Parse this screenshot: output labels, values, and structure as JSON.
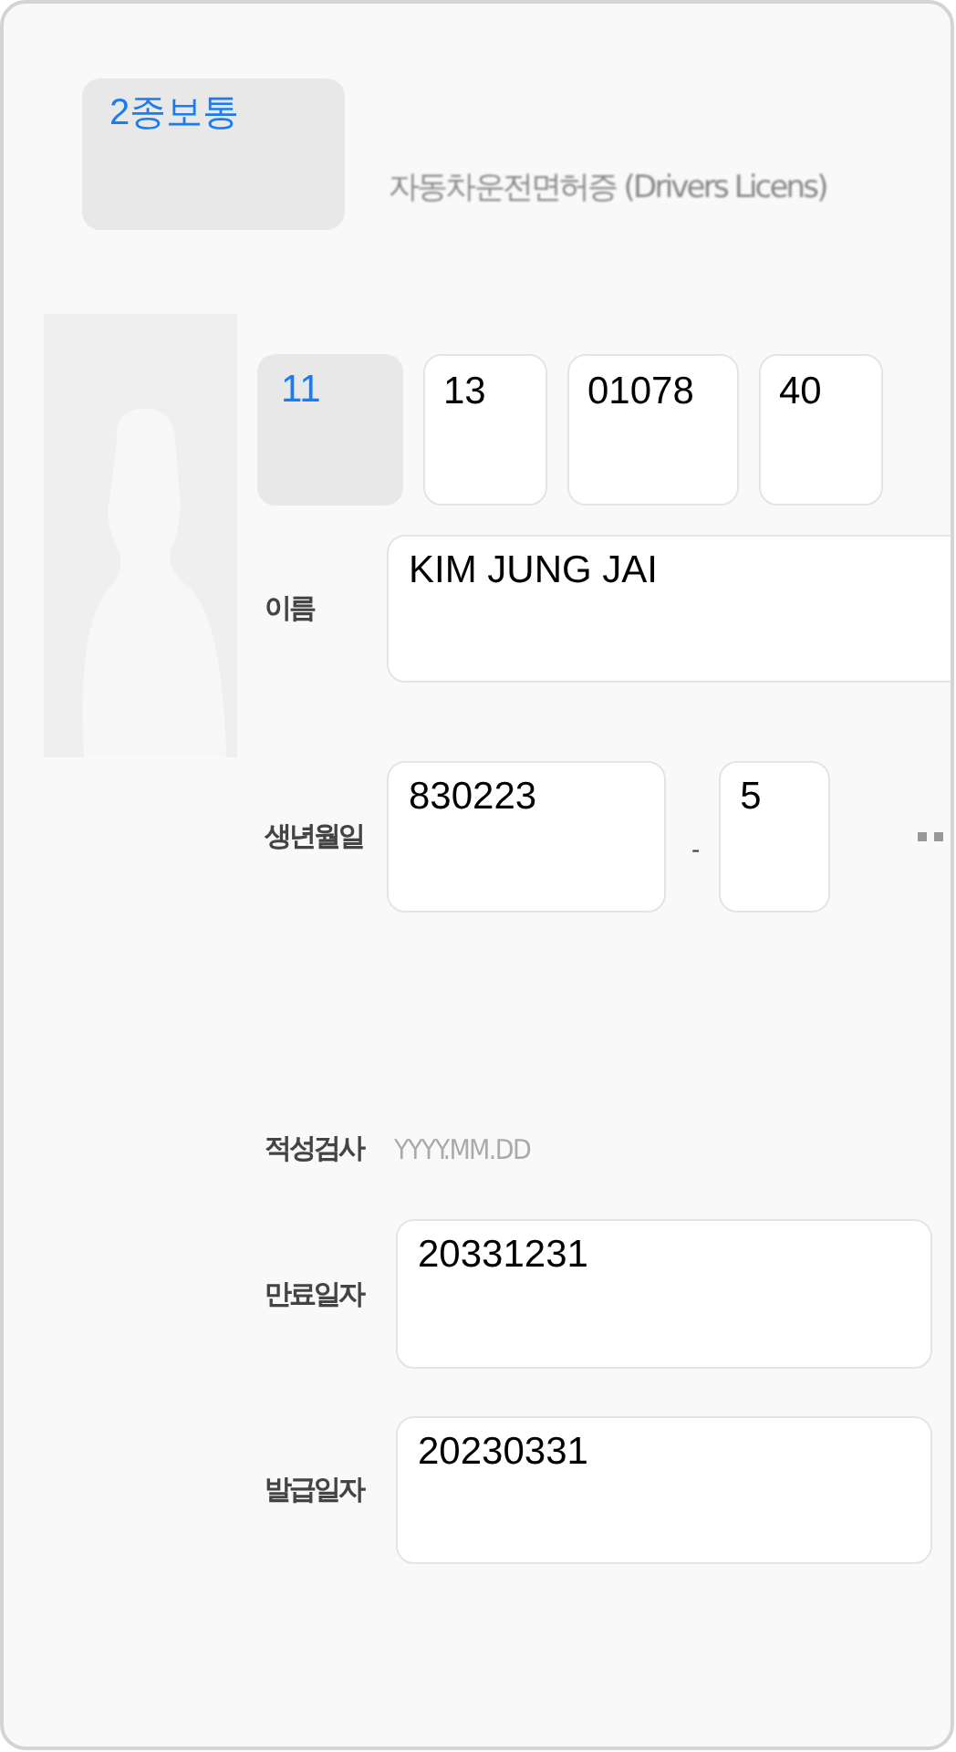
{
  "license_type": {
    "text": "2종보통",
    "editable": false
  },
  "title": "자동차운전면허증 (Drivers Licens)",
  "photo": {
    "kind": "silhouette"
  },
  "license_number": [
    {
      "value": "11",
      "editable": false
    },
    {
      "value": "13",
      "editable": true
    },
    {
      "value": "01078",
      "editable": true
    },
    {
      "value": "40",
      "editable": true
    }
  ],
  "name": {
    "label": "이름",
    "value": "KIM JUNG JAI"
  },
  "birth": {
    "label": "생년월일",
    "front": "830223",
    "separator": "-",
    "back": "5",
    "masked": true
  },
  "aptitude_test": {
    "label": "적성검사",
    "placeholder": "YYYY.MM.DD"
  },
  "expiry": {
    "label": "만료일자",
    "value": "20331231"
  },
  "issued": {
    "label": "발급일자",
    "value": "20230331"
  }
}
